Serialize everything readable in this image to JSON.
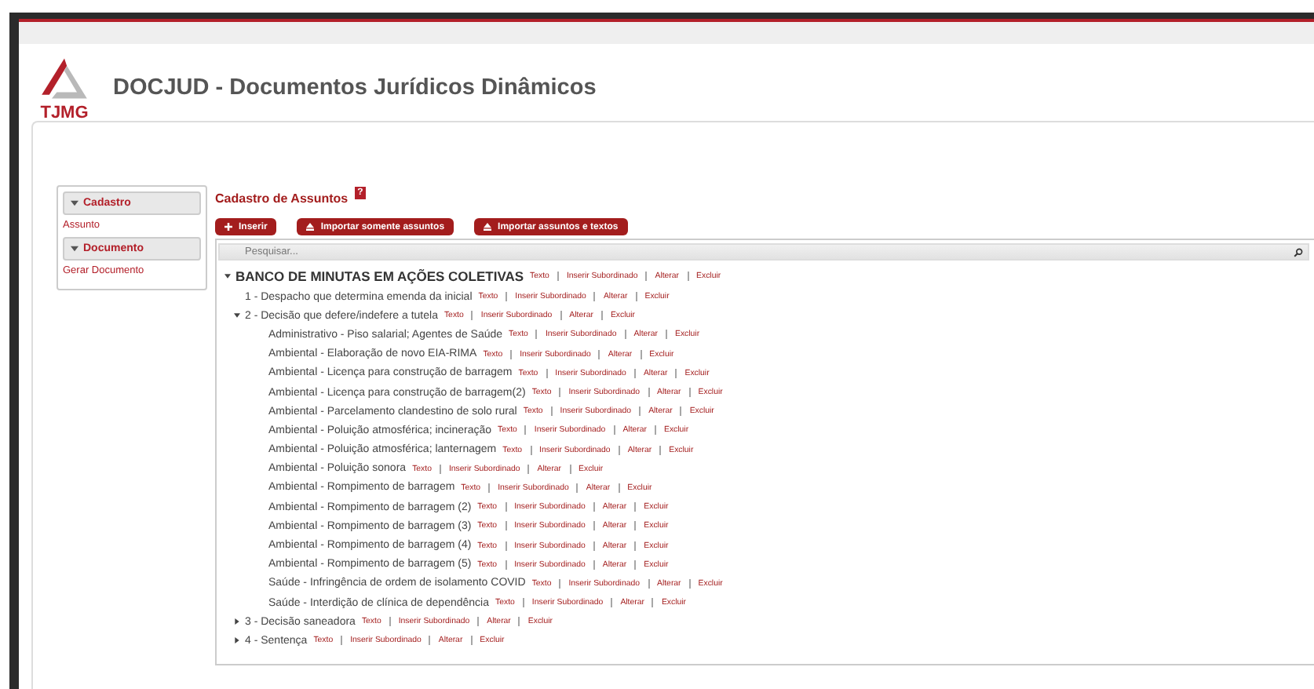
{
  "header": {
    "logo_text": "TJMG",
    "title": "DOCJUD - Documentos Jurídicos Dinâmicos"
  },
  "sidebar": {
    "sections": [
      {
        "title": "Cadastro",
        "expanded": true,
        "items": [
          "Assunto"
        ]
      },
      {
        "title": "Documento",
        "expanded": true,
        "items": [
          "Gerar Documento"
        ]
      }
    ]
  },
  "main": {
    "title": "Cadastro de Assuntos",
    "help": "?",
    "buttons": [
      {
        "label": "Inserir",
        "kind": "plus"
      },
      {
        "label": "Importar somente assuntos",
        "kind": "import"
      },
      {
        "label": "Importar assuntos e textos",
        "kind": "import"
      }
    ],
    "search": {
      "placeholder": "Pesquisar..."
    },
    "tree": [
      {
        "label": "BANCO DE MINUTAS EM AÇÕES COLETIVAS",
        "kind": "branch",
        "expanded": true,
        "actions": [
          "Texto",
          "Inserir Subordinado",
          "Alterar",
          "Excluir"
        ],
        "children": [
          {
            "label": "1 - Despacho que determina emenda da inicial",
            "kind": "leaf",
            "actions": [
              "Texto",
              "Inserir Subordinado",
              "Alterar",
              "Excluir"
            ]
          },
          {
            "label": "2 - Decisão que defere/indefere a tutela",
            "kind": "branch",
            "expanded": true,
            "actions": [
              "Texto",
              "Inserir Subordinado",
              "Alterar",
              "Excluir"
            ],
            "children": [
              {
                "label": "Administrativo - Piso salarial; Agentes de Saúde",
                "kind": "leaf",
                "actions": [
                  "Texto",
                  "Inserir Subordinado",
                  "Alterar",
                  "Excluir"
                ]
              },
              {
                "label": "Ambiental - Elaboração de novo EIA-RIMA",
                "kind": "leaf",
                "actions": [
                  "Texto",
                  "Inserir Subordinado",
                  "Alterar",
                  "Excluir"
                ]
              },
              {
                "label": "Ambiental - Licença para construção de barragem",
                "kind": "leaf",
                "actions": [
                  "Texto",
                  "Inserir Subordinado",
                  "Alterar",
                  "Excluir"
                ]
              },
              {
                "label": "Ambiental - Licença para construção de barragem(2)",
                "kind": "leaf",
                "actions": [
                  "Texto",
                  "Inserir Subordinado",
                  "Alterar",
                  "Excluir"
                ]
              },
              {
                "label": "Ambiental - Parcelamento clandestino de solo rural",
                "kind": "leaf",
                "actions": [
                  "Texto",
                  "Inserir Subordinado",
                  "Alterar",
                  "Excluir"
                ]
              },
              {
                "label": "Ambiental - Poluição atmosférica; incineração",
                "kind": "leaf",
                "actions": [
                  "Texto",
                  "Inserir Subordinado",
                  "Alterar",
                  "Excluir"
                ]
              },
              {
                "label": "Ambiental - Poluição atmosférica; lanternagem",
                "kind": "leaf",
                "actions": [
                  "Texto",
                  "Inserir Subordinado",
                  "Alterar",
                  "Excluir"
                ]
              },
              {
                "label": "Ambiental - Poluição sonora",
                "kind": "leaf",
                "actions": [
                  "Texto",
                  "Inserir Subordinado",
                  "Alterar",
                  "Excluir"
                ]
              },
              {
                "label": "Ambiental - Rompimento de barragem",
                "kind": "leaf",
                "actions": [
                  "Texto",
                  "Inserir Subordinado",
                  "Alterar",
                  "Excluir"
                ]
              },
              {
                "label": "Ambiental - Rompimento de barragem (2)",
                "kind": "leaf",
                "actions": [
                  "Texto",
                  "Inserir Subordinado",
                  "Alterar",
                  "Excluir"
                ]
              },
              {
                "label": "Ambiental - Rompimento de barragem (3)",
                "kind": "leaf",
                "actions": [
                  "Texto",
                  "Inserir Subordinado",
                  "Alterar",
                  "Excluir"
                ]
              },
              {
                "label": "Ambiental - Rompimento de barragem (4)",
                "kind": "leaf",
                "actions": [
                  "Texto",
                  "Inserir Subordinado",
                  "Alterar",
                  "Excluir"
                ]
              },
              {
                "label": "Ambiental - Rompimento de barragem (5)",
                "kind": "leaf",
                "actions": [
                  "Texto",
                  "Inserir Subordinado",
                  "Alterar",
                  "Excluir"
                ]
              },
              {
                "label": "Saúde - Infringência de ordem de isolamento COVID",
                "kind": "leaf",
                "actions": [
                  "Texto",
                  "Inserir Subordinado",
                  "Alterar",
                  "Excluir"
                ]
              },
              {
                "label": "Saúde - Interdição de clínica de dependência",
                "kind": "leaf",
                "actions": [
                  "Texto",
                  "Inserir Subordinado",
                  "Alterar",
                  "Excluir"
                ]
              }
            ]
          },
          {
            "label": "3 - Decisão saneadora",
            "kind": "branch",
            "expanded": false,
            "actions": [
              "Texto",
              "Inserir Subordinado",
              "Alterar",
              "Excluir"
            ]
          },
          {
            "label": "4 - Sentença",
            "kind": "branch",
            "expanded": false,
            "actions": [
              "Texto",
              "Inserir Subordinado",
              "Alterar",
              "Excluir"
            ]
          }
        ]
      }
    ]
  }
}
